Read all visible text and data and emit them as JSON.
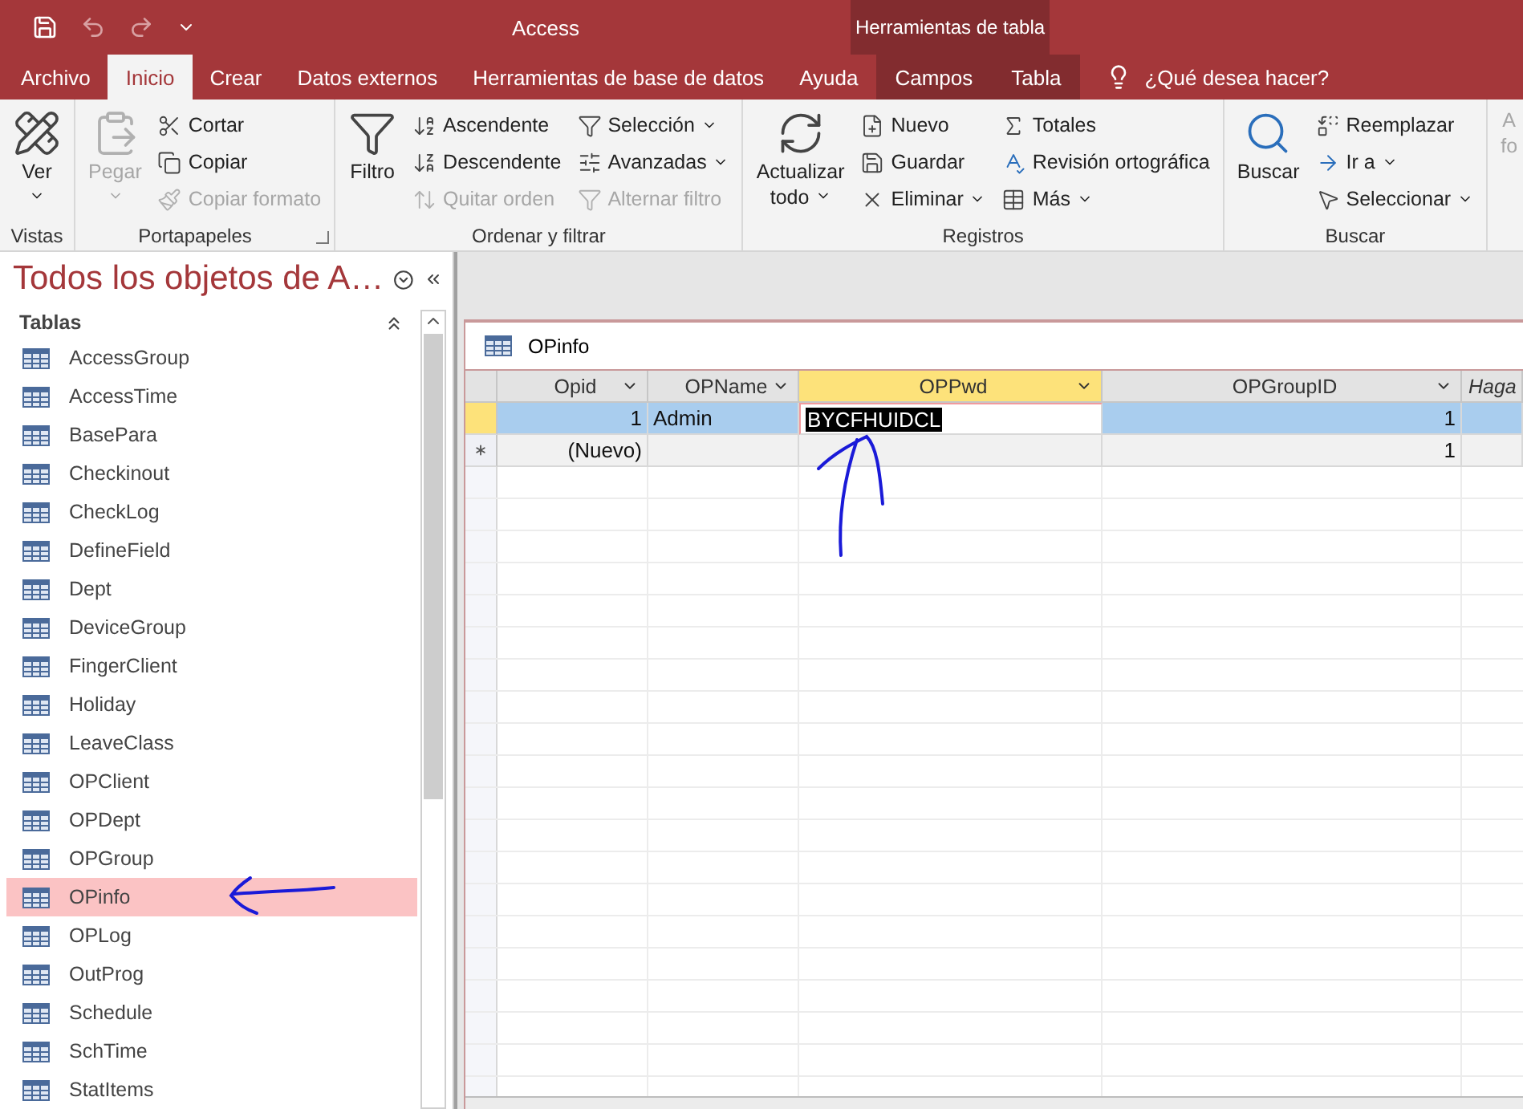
{
  "title_bar": {
    "title": "Access",
    "context_label": "Herramientas de tabla"
  },
  "ribbon_tabs": [
    {
      "label": "Archivo",
      "selected": false,
      "kind": "normal"
    },
    {
      "label": "Inicio",
      "selected": true,
      "kind": "normal"
    },
    {
      "label": "Crear",
      "selected": false,
      "kind": "normal"
    },
    {
      "label": "Datos externos",
      "selected": false,
      "kind": "normal"
    },
    {
      "label": "Herramientas de base de datos",
      "selected": false,
      "kind": "normal"
    },
    {
      "label": "Ayuda",
      "selected": false,
      "kind": "normal"
    },
    {
      "label": "Campos",
      "selected": false,
      "kind": "contextual"
    },
    {
      "label": "Tabla",
      "selected": false,
      "kind": "contextual"
    }
  ],
  "tell_me": {
    "placeholder": "¿Qué desea hacer?"
  },
  "ribbon_groups": [
    {
      "label": "Vistas",
      "large": [
        {
          "label": "Ver",
          "dropdown": true,
          "disabled": false
        }
      ]
    },
    {
      "label": "Portapapeles",
      "launcher": true,
      "large": [
        {
          "label": "Pegar",
          "dropdown": true,
          "disabled": true
        }
      ],
      "columns": [
        [
          {
            "label": "Cortar",
            "dropdown": false,
            "disabled": false
          },
          {
            "label": "Copiar",
            "dropdown": false,
            "disabled": false
          },
          {
            "label": "Copiar formato",
            "dropdown": false,
            "disabled": true
          }
        ]
      ]
    },
    {
      "label": "Ordenar y filtrar",
      "large": [
        {
          "label": "Filtro",
          "dropdown": false,
          "disabled": false
        }
      ],
      "columns": [
        [
          {
            "label": "Ascendente",
            "dropdown": false,
            "disabled": false
          },
          {
            "label": "Descendente",
            "dropdown": false,
            "disabled": false
          },
          {
            "label": "Quitar orden",
            "dropdown": false,
            "disabled": true
          }
        ],
        [
          {
            "label": "Selección",
            "dropdown": true,
            "disabled": false
          },
          {
            "label": "Avanzadas",
            "dropdown": true,
            "disabled": false
          },
          {
            "label": "Alternar filtro",
            "dropdown": false,
            "disabled": true
          }
        ]
      ]
    },
    {
      "label": "Registros",
      "large": [
        {
          "label": "Actualizar todo",
          "dropdown": true,
          "disabled": false
        }
      ],
      "columns": [
        [
          {
            "label": "Nuevo",
            "dropdown": false,
            "disabled": false
          },
          {
            "label": "Guardar",
            "dropdown": false,
            "disabled": false
          },
          {
            "label": "Eliminar",
            "dropdown": true,
            "disabled": false
          }
        ],
        [
          {
            "label": "Totales",
            "dropdown": false,
            "disabled": false
          },
          {
            "label": "Revisión ortográfica",
            "dropdown": false,
            "disabled": false
          },
          {
            "label": "Más",
            "dropdown": true,
            "disabled": false
          }
        ]
      ]
    },
    {
      "label": "Buscar",
      "large": [
        {
          "label": "Buscar",
          "dropdown": false,
          "disabled": false
        }
      ],
      "columns": [
        [
          {
            "label": "Reemplazar",
            "dropdown": false,
            "disabled": false
          },
          {
            "label": "Ir a",
            "dropdown": true,
            "disabled": false
          },
          {
            "label": "Seleccionar",
            "dropdown": true,
            "disabled": false
          }
        ]
      ]
    },
    {
      "large": [
        {
          "label": "A fo",
          "dropdown": false,
          "disabled": true
        }
      ]
    }
  ],
  "navigation_pane": {
    "title": "Todos los objetos de A…",
    "section": "Tablas",
    "items": [
      {
        "label": "AccessGroup",
        "selected": false
      },
      {
        "label": "AccessTime",
        "selected": false
      },
      {
        "label": "BasePara",
        "selected": false
      },
      {
        "label": "Checkinout",
        "selected": false
      },
      {
        "label": "CheckLog",
        "selected": false
      },
      {
        "label": "DefineField",
        "selected": false
      },
      {
        "label": "Dept",
        "selected": false
      },
      {
        "label": "DeviceGroup",
        "selected": false
      },
      {
        "label": "FingerClient",
        "selected": false
      },
      {
        "label": "Holiday",
        "selected": false
      },
      {
        "label": "LeaveClass",
        "selected": false
      },
      {
        "label": "OPClient",
        "selected": false
      },
      {
        "label": "OPDept",
        "selected": false
      },
      {
        "label": "OPGroup",
        "selected": false
      },
      {
        "label": "OPinfo",
        "selected": true
      },
      {
        "label": "OPLog",
        "selected": false
      },
      {
        "label": "OutProg",
        "selected": false
      },
      {
        "label": "Schedule",
        "selected": false
      },
      {
        "label": "SchTime",
        "selected": false
      },
      {
        "label": "StatItems",
        "selected": false
      }
    ]
  },
  "document": {
    "title": "OPinfo",
    "columns": [
      {
        "label": "Opid",
        "selected": false,
        "kind": "field"
      },
      {
        "label": "OPName",
        "selected": false,
        "kind": "field"
      },
      {
        "label": "OPPwd",
        "selected": true,
        "kind": "field"
      },
      {
        "label": "OPGroupID",
        "selected": false,
        "kind": "field"
      },
      {
        "label": "Haga",
        "selected": false,
        "kind": "add"
      }
    ],
    "rows": [
      {
        "kind": "record",
        "selected": true,
        "cells": [
          {
            "text": "1",
            "selected": false
          },
          {
            "text": "Admin",
            "selected": false
          },
          {
            "text": "BYCFHUIDCL",
            "selected": true
          },
          {
            "text": "1",
            "selected": false
          }
        ]
      },
      {
        "kind": "new",
        "selected": false,
        "cells": [
          {
            "text": "(Nuevo)",
            "selected": false
          },
          {
            "selected": false
          },
          {
            "selected": false
          },
          {
            "text": "1",
            "selected": false
          }
        ]
      }
    ]
  }
}
